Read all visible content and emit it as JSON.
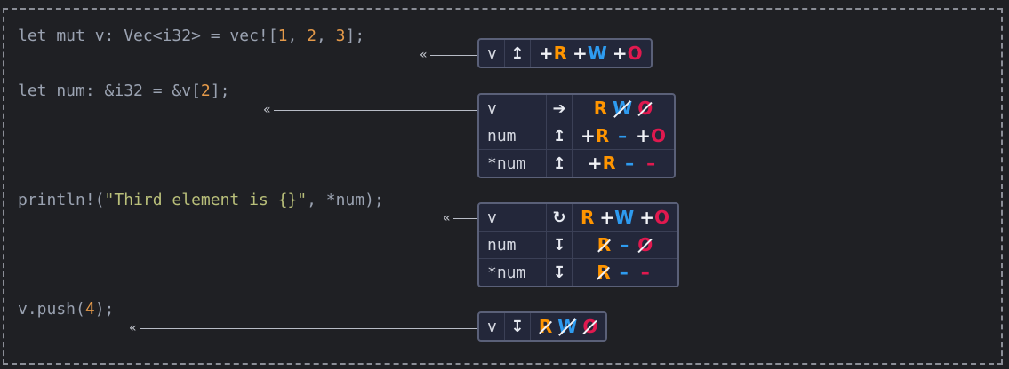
{
  "code_lines": [
    {
      "id": "line1",
      "parts": [
        {
          "text": "let mut v: Vec<i32> = vec![",
          "cls": "kw"
        },
        {
          "text": "1",
          "cls": "num-lit"
        },
        {
          "text": ", ",
          "cls": "kw"
        },
        {
          "text": "2",
          "cls": "num-lit"
        },
        {
          "text": ", ",
          "cls": "kw"
        },
        {
          "text": "3",
          "cls": "num-lit"
        },
        {
          "text": "];",
          "cls": "kw"
        }
      ]
    },
    {
      "id": "line2",
      "parts": [
        {
          "text": "let num: &i32 = &v[",
          "cls": "kw"
        },
        {
          "text": "2",
          "cls": "num-lit"
        },
        {
          "text": "];",
          "cls": "kw"
        }
      ]
    },
    {
      "id": "line3",
      "parts": [
        {
          "text": "println!(",
          "cls": "kw"
        },
        {
          "text": "\"Third element is {}\"",
          "cls": "str"
        },
        {
          "text": ", *num);",
          "cls": "kw"
        }
      ]
    },
    {
      "id": "line4",
      "parts": [
        {
          "text": "v.push(",
          "cls": "kw"
        },
        {
          "text": "4",
          "cls": "num-lit"
        },
        {
          "text": ");",
          "cls": "kw"
        }
      ]
    }
  ],
  "connector_glyph": "«",
  "tables": [
    {
      "id": "t1",
      "rows": [
        {
          "path": "v",
          "action": "↥",
          "perms": [
            {
              "kind": "r",
              "text": "R",
              "state": "gain"
            },
            {
              "kind": "w",
              "text": "W",
              "state": "gain"
            },
            {
              "kind": "o",
              "text": "O",
              "state": "gain"
            }
          ]
        }
      ]
    },
    {
      "id": "t2",
      "rows": [
        {
          "path": "v",
          "action": "➔",
          "perms": [
            {
              "kind": "r",
              "text": "R",
              "state": "keep"
            },
            {
              "kind": "w",
              "text": "W",
              "state": "lost"
            },
            {
              "kind": "o",
              "text": "O",
              "state": "lost"
            }
          ]
        },
        {
          "path": "num",
          "action": "↥",
          "perms": [
            {
              "kind": "r",
              "text": "R",
              "state": "gain"
            },
            {
              "kind": "w",
              "text": "–",
              "state": "none"
            },
            {
              "kind": "o",
              "text": "O",
              "state": "gain"
            }
          ]
        },
        {
          "path": "*num",
          "action": "↥",
          "perms": [
            {
              "kind": "r",
              "text": "R",
              "state": "gain"
            },
            {
              "kind": "w",
              "text": "–",
              "state": "none"
            },
            {
              "kind": "o",
              "text": "–",
              "state": "none"
            }
          ]
        }
      ]
    },
    {
      "id": "t3",
      "rows": [
        {
          "path": "v",
          "action": "↻",
          "perms": [
            {
              "kind": "r",
              "text": "R",
              "state": "keep"
            },
            {
              "kind": "w",
              "text": "W",
              "state": "gain"
            },
            {
              "kind": "o",
              "text": "O",
              "state": "gain"
            }
          ]
        },
        {
          "path": "num",
          "action": "↧",
          "perms": [
            {
              "kind": "r",
              "text": "R",
              "state": "lost"
            },
            {
              "kind": "w",
              "text": "–",
              "state": "none"
            },
            {
              "kind": "o",
              "text": "O",
              "state": "lost"
            }
          ]
        },
        {
          "path": "*num",
          "action": "↧",
          "perms": [
            {
              "kind": "r",
              "text": "R",
              "state": "lost"
            },
            {
              "kind": "w",
              "text": "–",
              "state": "none"
            },
            {
              "kind": "o",
              "text": "–",
              "state": "none"
            }
          ]
        }
      ]
    },
    {
      "id": "t4",
      "rows": [
        {
          "path": "v",
          "action": "↧",
          "perms": [
            {
              "kind": "r",
              "text": "R",
              "state": "lost"
            },
            {
              "kind": "w",
              "text": "W",
              "state": "lost"
            },
            {
              "kind": "o",
              "text": "O",
              "state": "lost"
            }
          ]
        }
      ]
    }
  ],
  "colors": {
    "read": "#ff9500",
    "write": "#2e9bf0",
    "own": "#e0194f",
    "background": "#1f2024"
  }
}
